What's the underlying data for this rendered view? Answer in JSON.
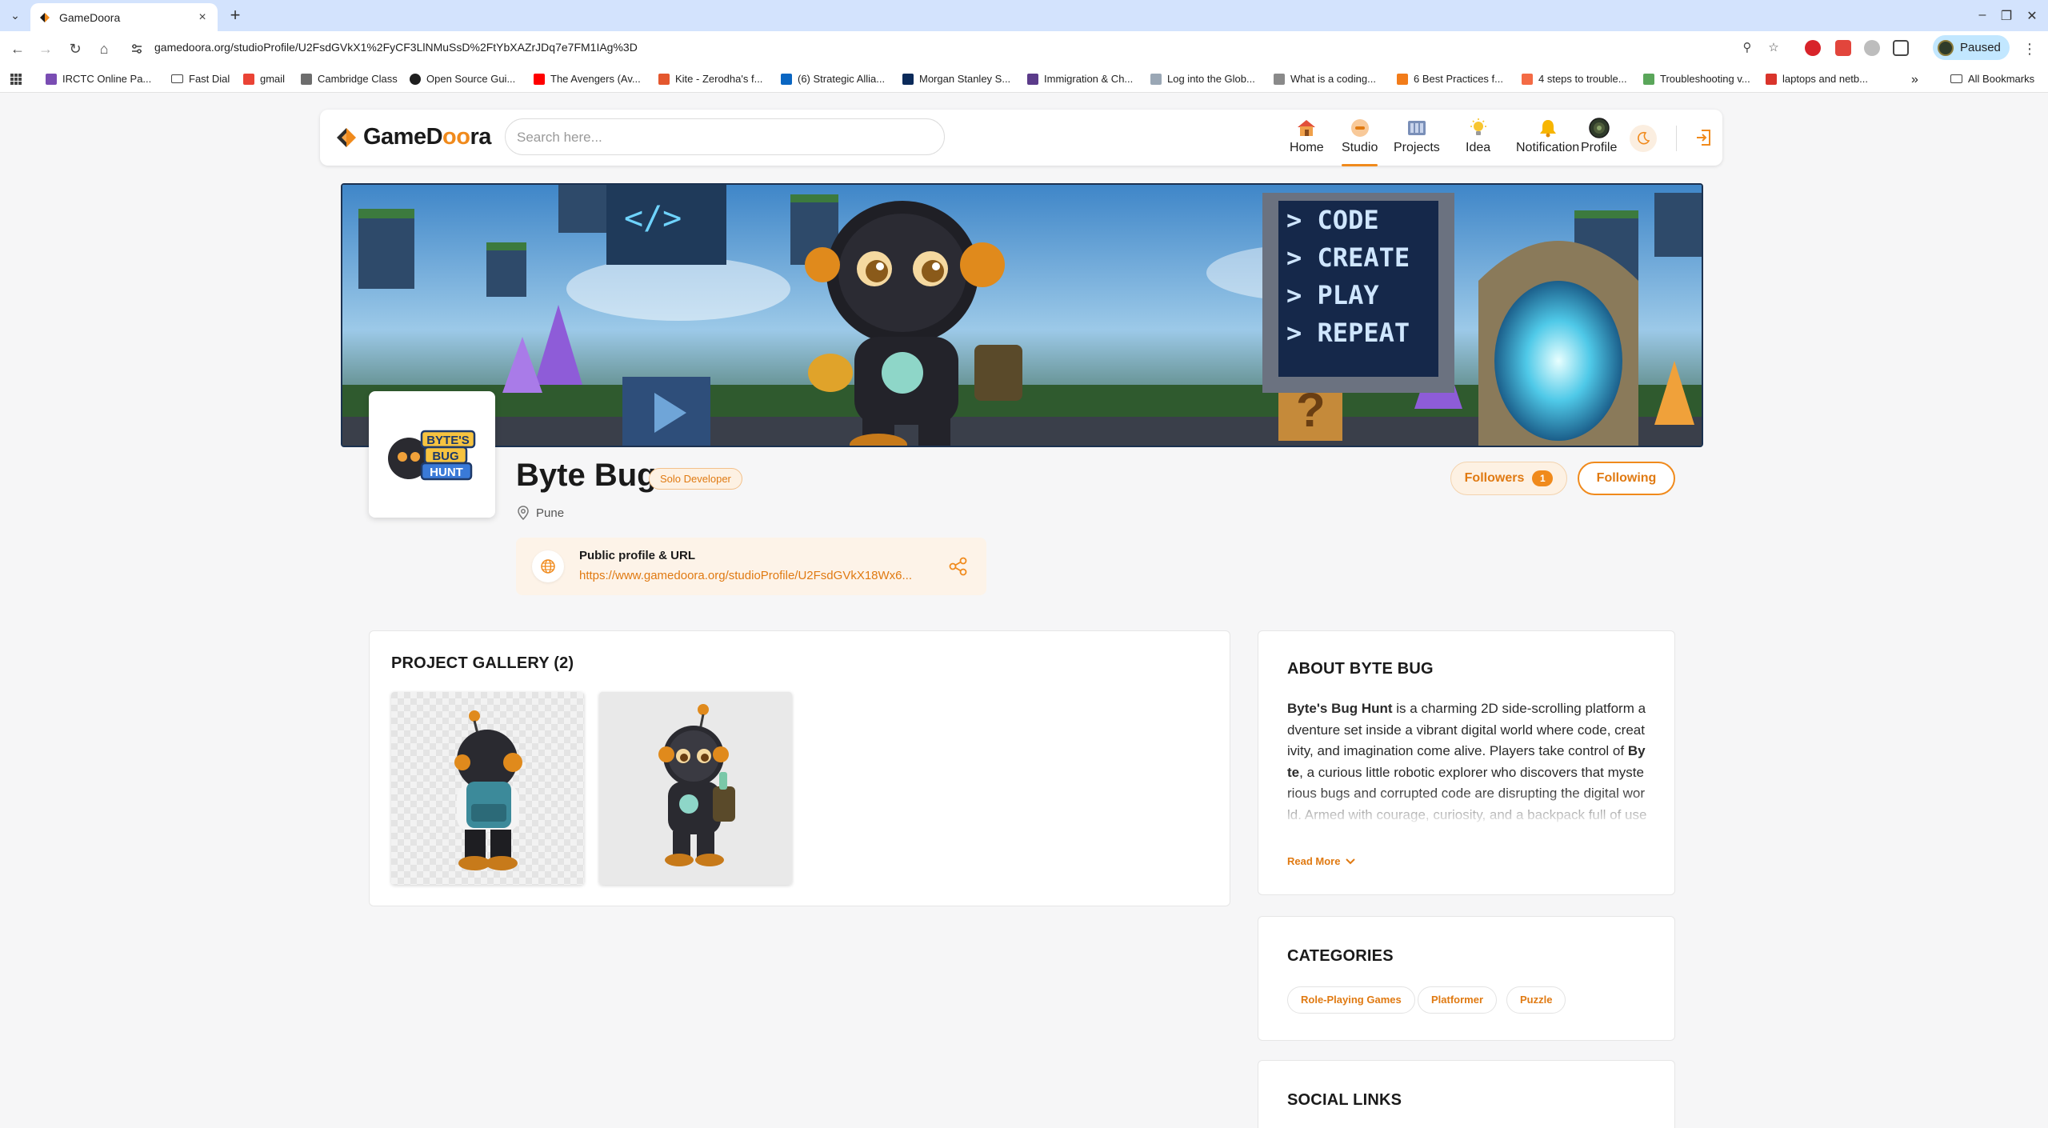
{
  "browser": {
    "tab_title": "GameDoora",
    "url": "gamedoora.org/studioProfile/U2FsdGVkX1%2FyCF3LlNMuSsD%2FtYbXAZrJDq7e7FM1IAg%3D",
    "profile_status": "Paused",
    "bookmarks": [
      "IRCTC Online Pa...",
      "Fast Dial",
      "gmail",
      "Cambridge Class",
      "Open Source Gui...",
      "The Avengers (Av...",
      "Kite - Zerodha's f...",
      "(6) Strategic Allia...",
      "Morgan Stanley S...",
      "Immigration & Ch...",
      "Log into the Glob...",
      "What is a coding...",
      "6 Best Practices f...",
      "4 steps to trouble...",
      "Troubleshooting v...",
      "laptops and netb..."
    ],
    "all_bookmarks": "All Bookmarks"
  },
  "header": {
    "logo": "GameDoora",
    "search_placeholder": "Search here...",
    "nav": [
      {
        "label": "Home",
        "icon": "home-icon"
      },
      {
        "label": "Studio",
        "icon": "studio-icon",
        "active": true
      },
      {
        "label": "Projects",
        "icon": "projects-icon"
      },
      {
        "label": "Idea",
        "icon": "idea-icon"
      },
      {
        "label": "Notification",
        "icon": "bell-icon"
      },
      {
        "label": "Profile",
        "icon": "avatar"
      }
    ],
    "accent_color": "#f08a1c"
  },
  "banner": {
    "lines": [
      "> CODE",
      "> CREATE",
      "> PLAY",
      "> REPEAT"
    ]
  },
  "profile": {
    "avatar_logo_lines": [
      "BYTE'S",
      "BUG",
      "HUNT"
    ],
    "name": "Byte Bug",
    "role": "Solo Developer",
    "location": "Pune",
    "followers_label": "Followers",
    "followers_count": "1",
    "following_label": "Following",
    "public_url_title": "Public profile & URL",
    "public_url": "https://www.gamedoora.org/studioProfile/U2FsdGVkX18Wx6..."
  },
  "gallery": {
    "title": "PROJECT GALLERY (2)"
  },
  "about": {
    "title": "ABOUT BYTE BUG",
    "text_parts": {
      "p1_bold": "Byte's Bug Hunt",
      "p1": " is a charming 2D side-scrolling platform adventure set inside a vibrant digital world where code, creativity, and imagination come alive. Players take control of ",
      "p2_bold": "Byte",
      "p2": ", a curious little robotic explorer who discovers that mysterious bugs and corrupted code are disrupting the digital world. Armed with courage, curiosity, and a backpack full of useful tools, Byte must tra"
    },
    "read_more": "Read More"
  },
  "categories": {
    "title": "CATEGORIES",
    "items": [
      "Role-Playing Games",
      "Platformer",
      "Puzzle"
    ]
  },
  "social": {
    "title": "SOCIAL LINKS"
  }
}
